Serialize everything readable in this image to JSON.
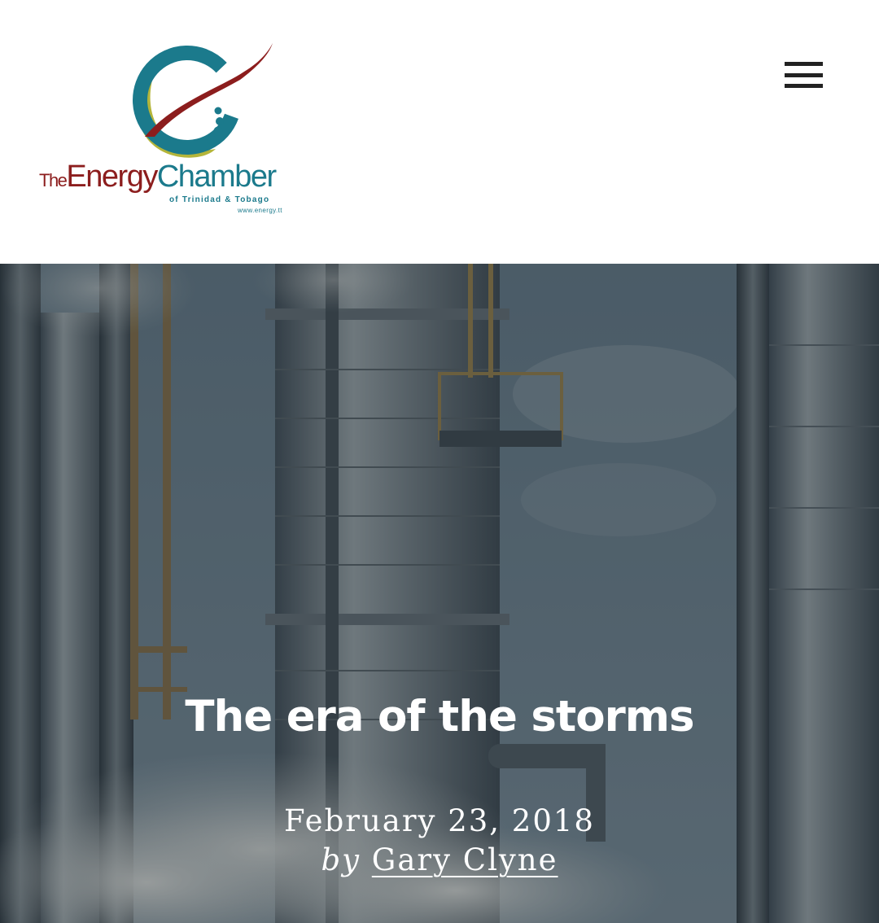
{
  "header": {
    "logo": {
      "word_the": "The",
      "word_energy": "Energy",
      "word_chamber": "Chamber",
      "subtitle": "of Trinidad & Tobago",
      "url": "www.energy.tt",
      "colors": {
        "teal": "#1b7a8c",
        "maroon": "#8c1d1d",
        "olive": "#b4b53a"
      }
    },
    "menu_icon": "hamburger-menu-icon"
  },
  "hero": {
    "image_subject": "industrial refinery towers with steam",
    "title": "The era of the storms",
    "date": "February 23, 2018",
    "by": "by",
    "author": "Gary Clyne"
  },
  "colors": {
    "header_background": "#ffffff",
    "hero_overlay": "#2c3a46",
    "hero_text": "#ffffff"
  }
}
